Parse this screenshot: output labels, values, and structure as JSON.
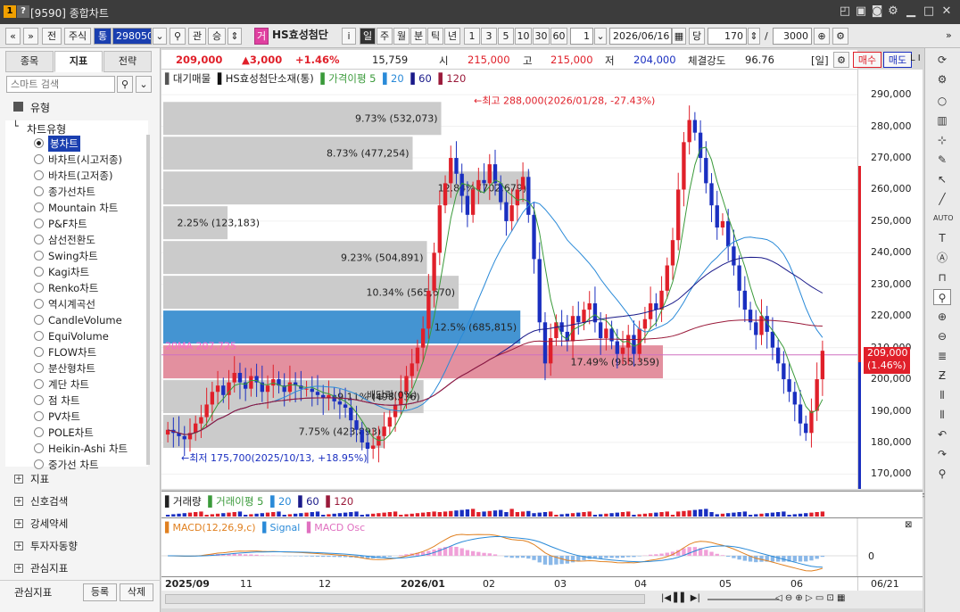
{
  "window": {
    "badge1": "1",
    "badge2": "?",
    "title": "[9590] 종합차트"
  },
  "toolbar": {
    "b_prev": "«",
    "b_down": "»",
    "b_jeon": "전",
    "b_stock": "주식",
    "b_tong": "통",
    "code": "298050",
    "b_gwan": "관",
    "b_seung": "승",
    "b_geo": "거",
    "name": "HS효성첨단",
    "b_i": "i",
    "p_il": "일",
    "p_ju": "주",
    "p_wol": "월",
    "p_bun": "분",
    "p_tik": "틱",
    "p_nyeon": "년",
    "n1": "1",
    "n3": "3",
    "n5": "5",
    "n10": "10",
    "n30": "30",
    "n60": "60",
    "interval": "1",
    "date": "2026/06/16",
    "b_dang": "당",
    "count": "170",
    "slash": "/",
    "total": "3000"
  },
  "left": {
    "tab1": "종목",
    "tab2": "지표",
    "tab3": "전략",
    "search_placeholder": "스마트 검색",
    "type_label": "유형",
    "chart_type_label": "차트유형",
    "chart_types": [
      "봉차트",
      "바차트(시고저종)",
      "바차트(고저종)",
      "종가선차트",
      "Mountain 차트",
      "P&F차트",
      "삼선전환도",
      "Swing차트",
      "Kagi차트",
      "Renko차트",
      "역시계곡선",
      "CandleVolume",
      "EquiVolume",
      "FLOW차트",
      "분산형차트",
      "계단 차트",
      "점 차트",
      "PV차트",
      "POLE차트",
      "Heikin-Ashi 차트",
      "중가선 차트"
    ],
    "groups": [
      "지표",
      "신호검색",
      "강세약세",
      "투자자동향",
      "관심지표"
    ],
    "fav_label": "관심지표",
    "reg_btn": "등록",
    "del_btn": "삭제"
  },
  "quote": {
    "price": "209,000",
    "change": "▲3,000",
    "pct": "+1.46%",
    "volume": "15,759",
    "open_l": "시",
    "open": "215,000",
    "high_l": "고",
    "high": "215,000",
    "low_l": "저",
    "low": "204,000",
    "strength_l": "체결강도",
    "strength": "96.76",
    "period": "[일]",
    "buy": "매수",
    "sell": "매도"
  },
  "legend": {
    "a": "대기매물",
    "b": "HS효성첨단소재(통)",
    "c": "가격이평 5",
    "d": "20",
    "e": "60",
    "f": "120"
  },
  "annotations": {
    "high": "←최고 288,000(2026/01/28, -27.43%)",
    "low": "←최저 175,700(2025/10/13, +18.95%)",
    "ma20": "20MA 207,725",
    "dividend": "배당락(0%)"
  },
  "price_label": {
    "price": "209,000",
    "pct": "(1.46%)"
  },
  "vol_legend": {
    "a": "거래량",
    "b": "거래이평 5",
    "c": "20",
    "d": "60",
    "e": "120"
  },
  "macd_legend": {
    "a": "MACD(12,26,9,c)",
    "b": "Signal",
    "c": "MACD Osc"
  },
  "macd_zero": "0",
  "x_labels": [
    "2025/09",
    "11",
    "12",
    "2026/01",
    "02",
    "03",
    "04",
    "05",
    "06"
  ],
  "x_end": "06/21",
  "colors": {
    "up": "#e0202a",
    "down": "#1a2fc0",
    "ma5": "#3a9a3a",
    "ma20": "#2a8ad8",
    "ma60": "#1a1a8a",
    "ma120": "#9a1a3a"
  },
  "chart_data": {
    "type": "candlestick",
    "y_ticks": [
      290000,
      280000,
      270000,
      260000,
      250000,
      240000,
      230000,
      220000,
      210000,
      200000,
      190000,
      180000,
      170000
    ],
    "ylim": [
      167000,
      294000
    ],
    "volume_profile": [
      {
        "low": 277000,
        "high": 288000,
        "pct": "9.73%",
        "vol": "(532,073)"
      },
      {
        "low": 266000,
        "high": 277000,
        "pct": "8.73%",
        "vol": "(477,254)"
      },
      {
        "low": 255000,
        "high": 266000,
        "pct": "12.84%",
        "vol": "(702,679)"
      },
      {
        "low": 244000,
        "high": 255000,
        "pct": "2.25%",
        "vol": "(123,183)"
      },
      {
        "low": 233000,
        "high": 244000,
        "pct": "9.23%",
        "vol": "(504,891)"
      },
      {
        "low": 222000,
        "high": 233000,
        "pct": "10.34%",
        "vol": "(565,670)"
      },
      {
        "low": 211000,
        "high": 222000,
        "pct": "12.5%",
        "vol": "(685,815)"
      },
      {
        "low": 200000,
        "high": 211000,
        "pct": "17.49%",
        "vol": "(955,359)"
      },
      {
        "low": 189000,
        "high": 200000,
        "pct": "9.11%",
        "vol": "(498,236)"
      },
      {
        "low": 178000,
        "high": 189000,
        "pct": "7.75%",
        "vol": "(423,893)"
      }
    ],
    "closes": [
      184,
      183,
      182,
      181,
      183,
      186,
      188,
      192,
      196,
      198,
      195,
      199,
      202,
      199,
      197,
      201,
      199,
      196,
      198,
      200,
      198,
      196,
      199,
      198,
      197,
      197,
      196,
      195,
      194,
      195,
      193,
      192,
      191,
      187,
      184,
      180,
      178,
      179,
      182,
      185,
      188,
      192,
      196,
      201,
      205,
      210,
      216,
      228,
      240,
      255,
      262,
      270,
      265,
      258,
      252,
      260,
      263,
      262,
      268,
      262,
      256,
      250,
      255,
      260,
      264,
      252,
      238,
      218,
      205,
      213,
      218,
      215,
      212,
      220,
      218,
      222,
      224,
      218,
      213,
      216,
      212,
      208,
      210,
      214,
      208,
      216,
      219,
      224,
      222,
      228,
      236,
      244,
      260,
      275,
      282,
      278,
      270,
      262,
      255,
      248,
      250,
      242,
      236,
      228,
      222,
      218,
      214,
      220,
      215,
      210,
      205,
      200,
      196,
      192,
      186,
      183,
      190,
      200,
      209
    ]
  }
}
